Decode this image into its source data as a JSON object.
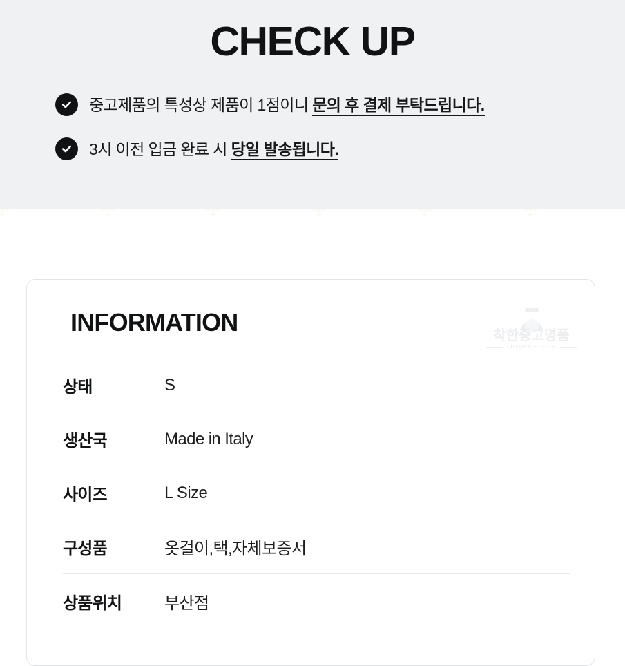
{
  "header": {
    "title": "CHECK UP",
    "background_color": "#f0f1f3",
    "items": [
      {
        "icon": "check-circle-icon",
        "text_plain": "중고제품의 특성상 제품이 1점이니 ",
        "text_emphasis": "문의 후 결제 부탁드립니다."
      },
      {
        "icon": "check-circle-icon",
        "text_plain": "3시 이전 입금 완료 시 ",
        "text_emphasis": "당일 발송됩니다."
      }
    ]
  },
  "watermark_strip": {
    "glyphs": "✣ ✣ ✣ ✣ ✣ ✣ ✣ ✣ ✣ ✣ ✣ ✣ ✣ ✣"
  },
  "info_card": {
    "title": "INFORMATION",
    "watermark": {
      "icon": "wristwatch-icon",
      "brand": "착한중고명품",
      "tagline": "LUXURY GOODS",
      "color": "#eceef0"
    },
    "rows": [
      {
        "label": "상태",
        "value": "S"
      },
      {
        "label": "생산국",
        "value": "Made in Italy"
      },
      {
        "label": "사이즈",
        "value": "L Size"
      },
      {
        "label": "구성품",
        "value": "옷걸이,택,자체보증서"
      },
      {
        "label": "상품위치",
        "value": "부산점"
      }
    ]
  },
  "colors": {
    "text_primary": "#111214",
    "header_bg": "#f0f1f3",
    "card_border": "#e3e4e6",
    "row_divider": "#e8e9eb",
    "icon_bg": "#111214"
  }
}
